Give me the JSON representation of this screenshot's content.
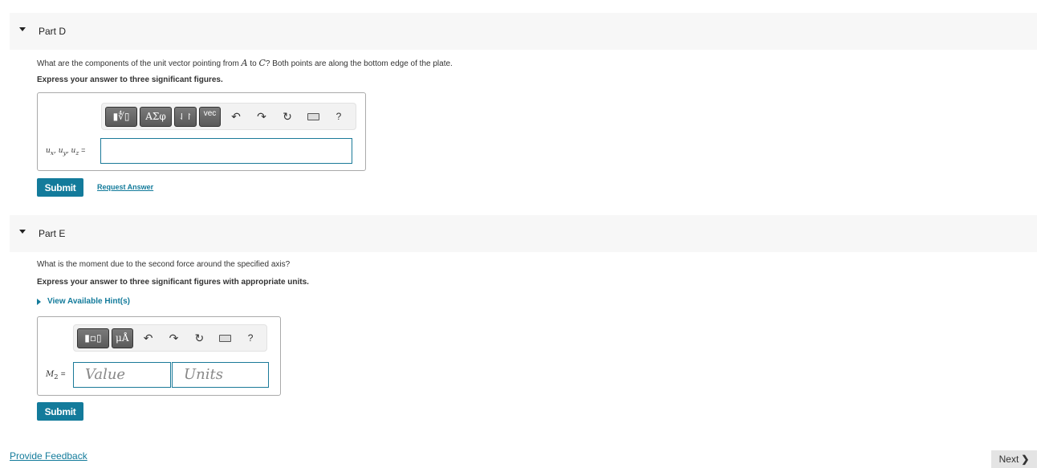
{
  "partD": {
    "title": "Part D",
    "question_pre": "What are the components of the unit vector pointing from ",
    "point_a": "A",
    "question_mid": " to ",
    "point_c": "C",
    "question_post": "? Both points are along the bottom edge of the plate.",
    "instruction": "Express your answer to three significant figures.",
    "toolbar": {
      "templates_label": "▮∜▯",
      "greek_label": "ΑΣφ",
      "sort_label": "⇃↾",
      "vec_label": "vec",
      "undo_icon": "↶",
      "redo_icon": "↷",
      "reset_icon": "↻",
      "help_label": "?"
    },
    "variable_label": "u",
    "variable_subs": [
      "x",
      "y",
      "z"
    ],
    "input_value": "",
    "submit_label": "Submit",
    "request_answer_label": "Request Answer"
  },
  "partE": {
    "title": "Part E",
    "question": "What is the moment due to the second force around the specified axis?",
    "instruction": "Express your answer to three significant figures with appropriate units.",
    "hint_label": "View Available Hint(s)",
    "toolbar": {
      "templates_label": "▮▫▯",
      "units_label": "μÅ",
      "undo_icon": "↶",
      "redo_icon": "↷",
      "reset_icon": "↻",
      "help_label": "?"
    },
    "variable_label": "M",
    "variable_sub": "2",
    "value_placeholder": "Value",
    "units_placeholder": "Units",
    "submit_label": "Submit"
  },
  "footer": {
    "feedback_label": "Provide Feedback",
    "next_label": "Next"
  }
}
